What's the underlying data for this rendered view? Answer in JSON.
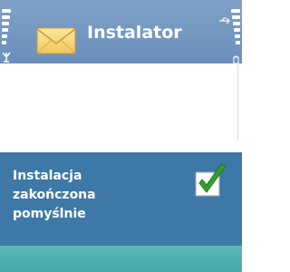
{
  "header": {
    "title": "Instalator",
    "app_icon": "envelope-icon",
    "signal_icon": "antenna-icon",
    "battery_icon": "battery-icon",
    "connectivity_icon": "usb-icon"
  },
  "note": {
    "lines": [
      "Instalacja",
      "zakończona",
      "pomyślnie"
    ],
    "icon": "checkmark-icon"
  },
  "colors": {
    "header": "#7fa1c7",
    "note_background": "#3d78a6",
    "bottom_bar": "#5ab9b4",
    "check_green": "#2fa12c"
  }
}
